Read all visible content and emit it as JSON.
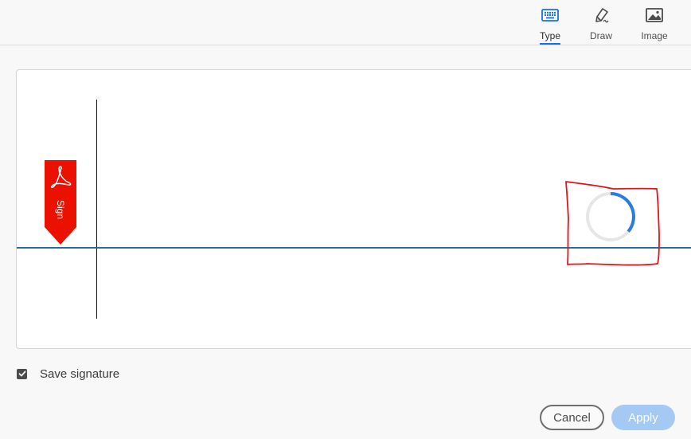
{
  "tabs": [
    {
      "label": "Type",
      "icon": "keyboard-icon",
      "active": true
    },
    {
      "label": "Draw",
      "icon": "pen-icon",
      "active": false
    },
    {
      "label": "Image",
      "icon": "image-icon",
      "active": false
    }
  ],
  "signature_area": {
    "badge_text": "Sign",
    "badge_icon": "acrobat-logo-icon",
    "badge_color": "#eb1000",
    "baseline_color": "#2a6f97",
    "loading": true,
    "spinner_accent": "#2d7be0",
    "annotation_color": "#e0141c"
  },
  "save_signature": {
    "label": "Save signature",
    "checked": true
  },
  "buttons": {
    "cancel_label": "Cancel",
    "apply_label": "Apply",
    "apply_enabled": false
  },
  "colors": {
    "accent": "#1473e6"
  }
}
